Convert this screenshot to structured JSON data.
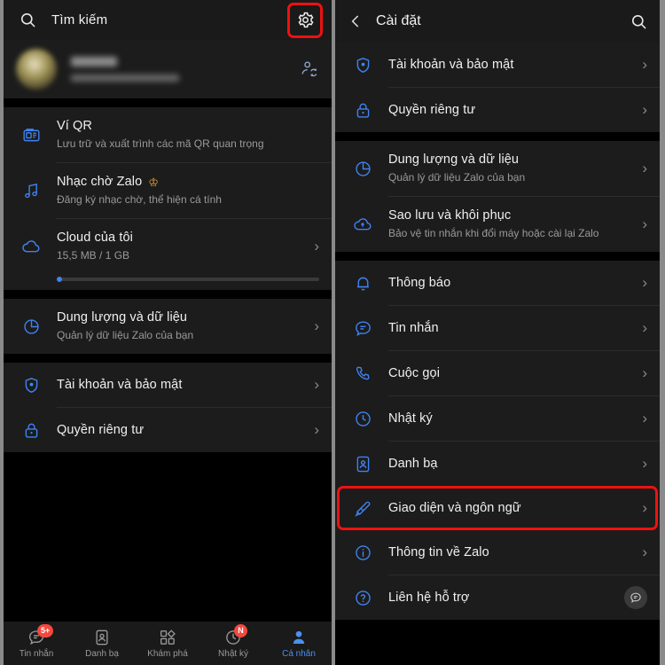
{
  "colors": {
    "accent_blue": "#3f82f0",
    "highlight_red": "#ee1111",
    "badge_red": "#f4483e",
    "crown_gold": "#e8a72c",
    "panel_bg": "#1c1c1c",
    "screen_bg": "#000000"
  },
  "left_panel": {
    "topbar": {
      "search_icon": "search-icon",
      "search_placeholder": "Tìm kiếm",
      "settings_icon": "gear-icon",
      "settings_highlighted": true
    },
    "profile": {
      "name": "",
      "subtitle": "",
      "blurred": true,
      "action_icon": "person-sync-icon"
    },
    "group_1": [
      {
        "icon": "qr-wallet-icon",
        "title": "Ví QR",
        "subtitle": "Lưu trữ và xuất trình các mã QR quan trọng",
        "chevron": false,
        "badge": ""
      },
      {
        "icon": "music-note-icon",
        "title": "Nhạc chờ Zalo",
        "subtitle": "Đăng ký nhạc chờ, thể hiện cá tính",
        "chevron": false,
        "badge": "crown"
      },
      {
        "icon": "cloud-icon",
        "title": "Cloud của tôi",
        "subtitle": "15,5 MB / 1 GB",
        "chevron": true,
        "badge": "",
        "progress_percent": 1.5
      }
    ],
    "group_2": [
      {
        "icon": "pie-chart-icon",
        "title": "Dung lượng và dữ liệu",
        "subtitle": "Quản lý dữ liệu Zalo của bạn",
        "chevron": true
      }
    ],
    "group_3": [
      {
        "icon": "shield-icon",
        "title": "Tài khoản và bảo mật",
        "subtitle": "",
        "chevron": true
      },
      {
        "icon": "lock-icon",
        "title": "Quyền riêng tư",
        "subtitle": "",
        "chevron": true
      }
    ],
    "bottom_nav": [
      {
        "icon": "message-icon",
        "label": "Tin nhắn",
        "badge": "5+",
        "active": false
      },
      {
        "icon": "contacts-icon",
        "label": "Danh bạ",
        "badge": "",
        "active": false
      },
      {
        "icon": "discover-icon",
        "label": "Khám phá",
        "badge": "",
        "active": false
      },
      {
        "icon": "clock-icon",
        "label": "Nhật ký",
        "badge": "N",
        "active": false
      },
      {
        "icon": "person-icon",
        "label": "Cá nhân",
        "badge": "",
        "active": true
      }
    ]
  },
  "right_panel": {
    "header": {
      "back_icon": "chevron-left-icon",
      "title": "Cài đặt",
      "search_icon": "search-icon"
    },
    "group_1": [
      {
        "icon": "shield-icon",
        "title": "Tài khoản và bảo mật",
        "subtitle": "",
        "chevron": true
      },
      {
        "icon": "lock-icon",
        "title": "Quyền riêng tư",
        "subtitle": "",
        "chevron": true
      }
    ],
    "group_2": [
      {
        "icon": "pie-chart-icon",
        "title": "Dung lượng và dữ liệu",
        "subtitle": "Quản lý dữ liệu Zalo của bạn",
        "chevron": true
      },
      {
        "icon": "backup-cloud-icon",
        "title": "Sao lưu và khôi phục",
        "subtitle": "Bảo vệ tin nhắn khi đổi máy hoặc cài lại Zalo",
        "chevron": true
      }
    ],
    "group_3": [
      {
        "icon": "bell-icon",
        "title": "Thông báo",
        "subtitle": "",
        "chevron": true
      },
      {
        "icon": "message-icon",
        "title": "Tin nhắn",
        "subtitle": "",
        "chevron": true
      },
      {
        "icon": "phone-icon",
        "title": "Cuộc gọi",
        "subtitle": "",
        "chevron": true
      },
      {
        "icon": "clock-icon",
        "title": "Nhật ký",
        "subtitle": "",
        "chevron": true
      },
      {
        "icon": "contacts-icon",
        "title": "Danh bạ",
        "subtitle": "",
        "chevron": true
      },
      {
        "icon": "brush-icon",
        "title": "Giao diện và ngôn ngữ",
        "subtitle": "",
        "chevron": true,
        "highlighted": true
      },
      {
        "icon": "info-icon",
        "title": "Thông tin về Zalo",
        "subtitle": "",
        "chevron": true
      },
      {
        "icon": "question-icon",
        "title": "Liên hệ hỗ trợ",
        "subtitle": "",
        "chevron": false,
        "support_button": "chat-bubble-icon"
      }
    ]
  }
}
